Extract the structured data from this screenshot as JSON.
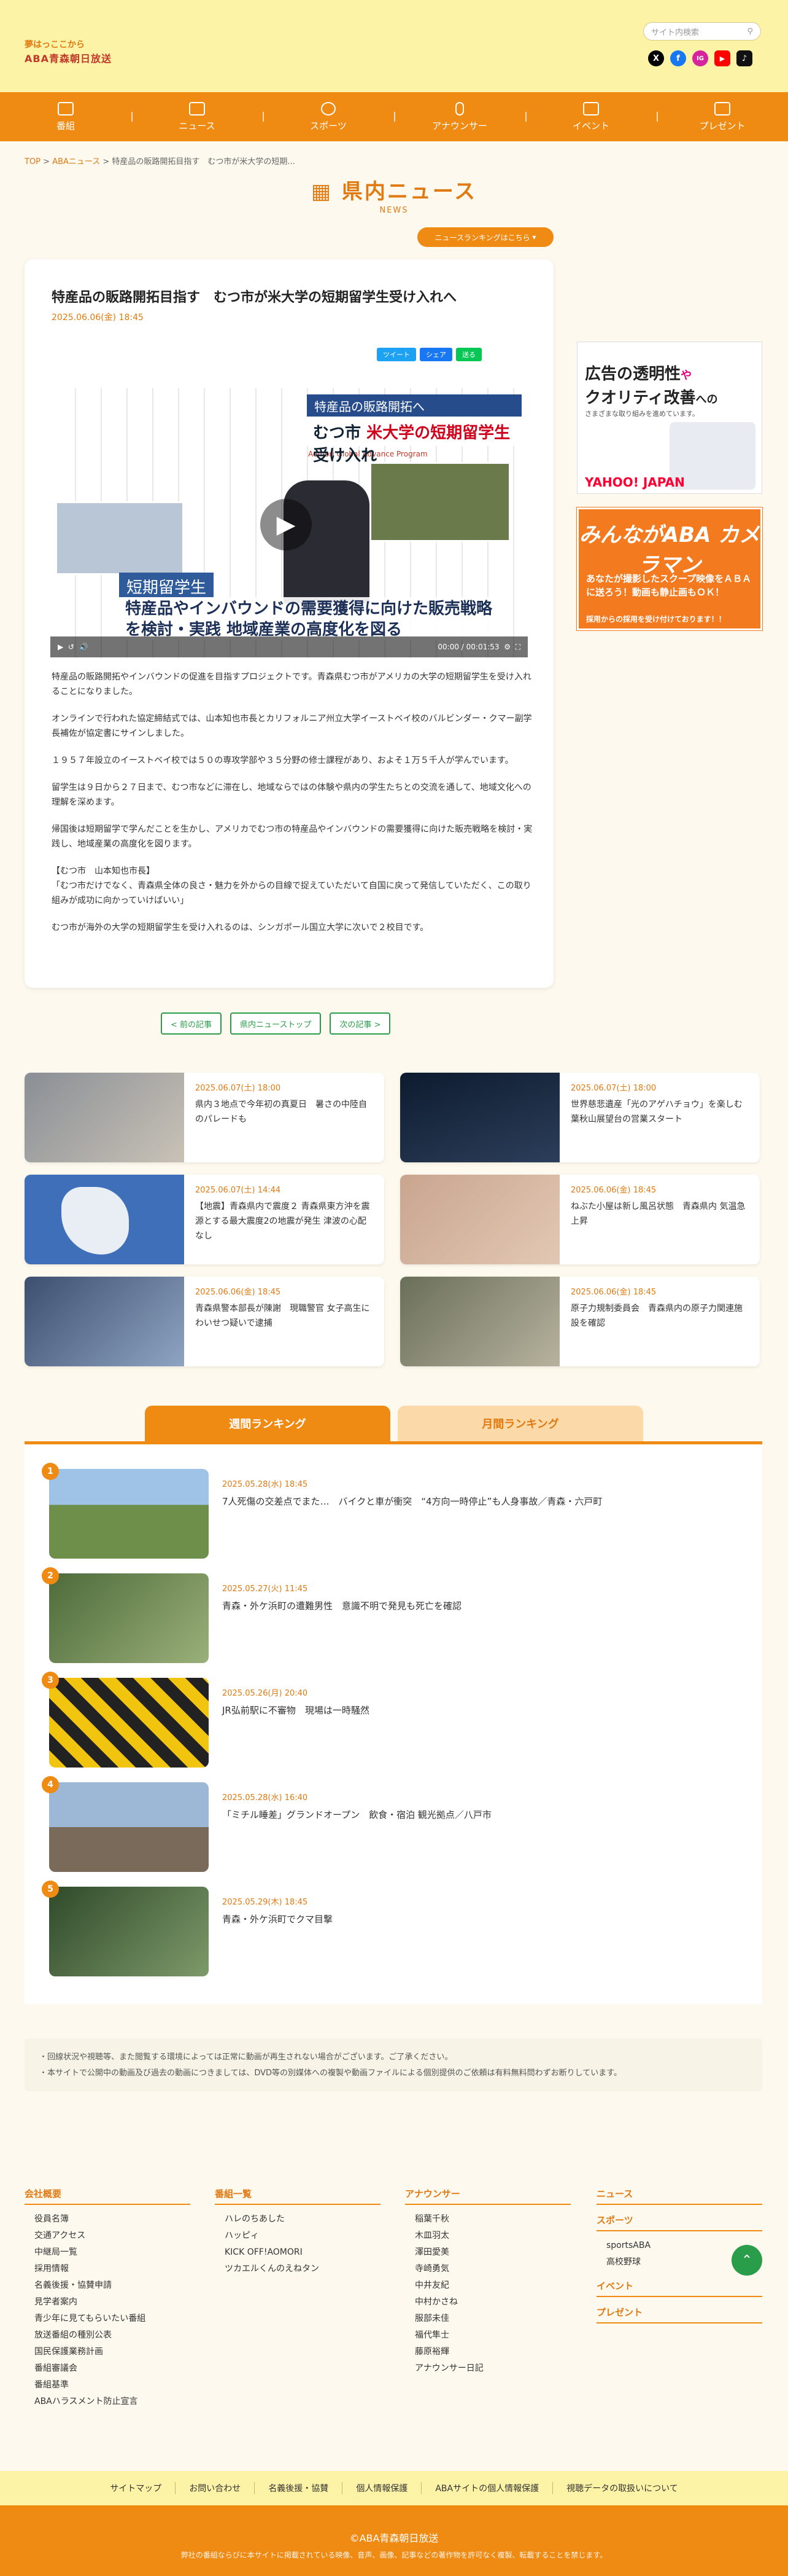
{
  "header": {
    "logo_line1": "夢はっここから",
    "logo_line2": "ABA青森朝日放送",
    "search_placeholder": "サイト内検索",
    "socials": [
      "X",
      "f",
      "IG",
      "▶",
      "♪"
    ]
  },
  "nav": [
    "番組",
    "ニュース",
    "スポーツ",
    "アナウンサー",
    "イベント",
    "プレゼント"
  ],
  "breadcrumb": [
    "TOP",
    "ABAニュース",
    "特産品の販路開拓目指す　むつ市が米大学の短期..."
  ],
  "section": {
    "title": "県内ニュース",
    "subtitle": "NEWS"
  },
  "ranking_link": "ニュースランキングはこちら",
  "article": {
    "title": "特産品の販路開拓目指す　むつ市が米大学の短期留学生受け入れへ",
    "date": "2025.06.06(金) 18:45",
    "share": [
      "ツイート",
      "シェア",
      "送る"
    ],
    "video": {
      "band1": "特産品の販路開拓へ",
      "band2_prefix": "むつ市 ",
      "band2_em": "米大学の短期留学生",
      "band2_suffix": "受け入れ",
      "caption_label": "短期留学生",
      "caption_main": "特産品やインバウンドの需要獲得に向けた販売戦略を検討・実践 地域産業の高度化を図る",
      "time": "00:00 / 00:01:53",
      "wall_text": "Aomori Global Advance Program"
    },
    "paragraphs": [
      "特産品の販路開拓やインバウンドの促進を目指すプロジェクトです。青森県むつ市がアメリカの大学の短期留学生を受け入れることになりました。",
      "オンラインで行われた協定締結式では、山本知也市長とカリフォルニア州立大学イーストベイ校のバルビンダー・クマー副学長補佐が協定書にサインしました。",
      "１９５７年設立のイーストベイ校では５０の専攻学部や３５分野の修士課程があり、およそ１万５千人が学んでいます。",
      "留学生は９日から２７日まで、むつ市などに滞在し、地域ならではの体験や県内の学生たちとの交流を通して、地域文化への理解を深めます。",
      "帰国後は短期留学で学んだことを生かし、アメリカでむつ市の特産品やインバウンドの需要獲得に向けた販売戦略を検討・実践し、地域産業の高度化を図ります。",
      "【むつ市　山本知也市長】\n「むつ市だけでなく、青森県全体の良さ・魅力を外からの目線で捉えていただいて自国に戻って発信していただく、この取り組みが成功に向かっていけばいい」",
      "むつ市が海外の大学の短期留学生を受け入れるのは、シンガポール国立大学に次いで２校目です。"
    ]
  },
  "ads": {
    "ad1_line1": "広告の透明性",
    "ad1_line1b": "や",
    "ad1_line2": "クオリティ改善",
    "ad1_line2b": "への",
    "ad1_sub": "さまざまな取り組みを進めています。",
    "ad1_brand": "YAHOO! JAPAN",
    "ad2_title": "みんながABA カメラマン",
    "ad2_body": "あなたが撮影したスクープ映像をＡＢＡに送ろう！動画も静止画もＯＫ！",
    "ad2_foot": "採用からの採用を受け付けております！！"
  },
  "pager": [
    "< 前の記事",
    "県内ニューストップ",
    "次の記事 >"
  ],
  "related": [
    {
      "date": "2025.06.07(土) 18:00",
      "title": "県内３地点で今年初の真夏日　暑さの中陸自のパレードも"
    },
    {
      "date": "2025.06.07(土) 18:00",
      "title": "世界慈悲遺産「光のアゲハチョウ」を楽しむ葉秋山展望台の営業スタート"
    },
    {
      "date": "2025.06.07(土) 14:44",
      "title": "【地震】青森県内で震度２ 青森県東方沖を震源とする最大震度2の地震が発生 津波の心配なし"
    },
    {
      "date": "2025.06.06(金) 18:45",
      "title": "ねぶた小屋は新し風呂状態　青森県内 気温急上昇"
    },
    {
      "date": "2025.06.06(金) 18:45",
      "title": "青森県警本部長が陳謝　現職警官 女子高生にわいせつ疑いで逮捕"
    },
    {
      "date": "2025.06.06(金) 18:45",
      "title": "原子力規制委員会　青森県内の原子力関連施設を確認"
    }
  ],
  "rank_tabs": [
    "週間ランキング",
    "月間ランキング"
  ],
  "ranking": [
    {
      "rank": "1",
      "date": "2025.05.28(水) 18:45",
      "title": "7人死傷の交差点でまた…　バイクと車が衝突　“4方向一時停止”も人身事故／青森・六戸町"
    },
    {
      "rank": "2",
      "date": "2025.05.27(火) 11:45",
      "title": "青森・外ケ浜町の遭難男性　意識不明で発見も死亡を確認"
    },
    {
      "rank": "3",
      "date": "2025.05.26(月) 20:40",
      "title": "JR弘前駅に不審物　現場は一時騒然"
    },
    {
      "rank": "4",
      "date": "2025.05.28(水) 16:40",
      "title": "「ミチル睡差」グランドオープン　飲食・宿泊 観光拠点／八戸市"
    },
    {
      "rank": "5",
      "date": "2025.05.29(木) 18:45",
      "title": "青森・外ケ浜町でクマ目撃"
    }
  ],
  "notice": [
    "・回線状況や視聴等、また閲覧する環境によっては正常に動画が再生されない場合がございます。ご了承ください。",
    "・本サイトで公開中の動画及び過去の動画につきましては、DVD等の別媒体への複製や動画ファイルによる個別提供のご依頼は有料無料問わずお断りしています。"
  ],
  "footer": {
    "col1_head": "会社概要",
    "col1": [
      "役員名簿",
      "交通アクセス",
      "中継局一覧",
      "採用情報",
      "名義後援・協賛申請",
      "見学者案内",
      "青少年に見てもらいたい番組",
      "放送番組の種別公表",
      "国民保護業務計画",
      "番組審議会",
      "番組基準",
      "ABAハラスメント防止宣言"
    ],
    "col2_head": "番組一覧",
    "col2": [
      "ハレのちあした",
      "ハッピィ",
      "KICK OFF!AOMORI",
      "ツカエルくんのえねタン"
    ],
    "col3_head": "アナウンサー",
    "col3": [
      "稲葉千秋",
      "木皿羽太",
      "澤田愛美",
      "寺崎勇気",
      "中井友紀",
      "中村かさね",
      "服部未佳",
      "福代隼士",
      "藤原裕輝",
      "アナウンサー日記"
    ],
    "col4_head": "ニュース",
    "col4_sports": "スポーツ",
    "col4_sports_items": [
      "sportsABA",
      "高校野球"
    ],
    "col4_event": "イベント",
    "col4_present": "プレゼント",
    "bottom_links": [
      "サイトマップ",
      "お問い合わせ",
      "名義後援・協賛",
      "個人情報保護",
      "ABAサイトの個人情報保護",
      "視聴データの取扱いについて"
    ],
    "copyright": "©ABA青森朝日放送",
    "copy_sub": "弊社の番組ならびに本サイトに掲載されている映像、音声、画像、記事などの著作物を許可なく複製、転載することを禁じます。"
  },
  "colors": {
    "accent": "#ef8a12",
    "header_bg": "#fdf3a6",
    "green": "#2a9d4a",
    "page_bg": "#fdf9ee"
  }
}
